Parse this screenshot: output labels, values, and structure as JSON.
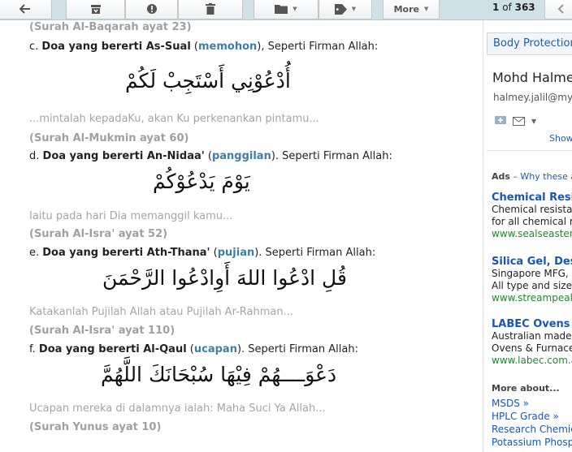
{
  "toolbar": {
    "more_label": "More",
    "pager": {
      "current": "1",
      "of_label": "of",
      "total": "363"
    }
  },
  "message": {
    "ref_baqarah": "(Surah Al-Baqarah ayat 23)",
    "c": {
      "prefix": "c. ",
      "title": "Doa yang bererti As-Sual",
      "open": " (",
      "keyword": "memohon",
      "close": "), Seperti Firman Allah:"
    },
    "c_arabic": "أُدْعُوْنِي أَسْتَجِبْ لَكُمْ",
    "c_trans": "...mintalah kepadaKu, akan Ku perkenankan pintamu...",
    "ref_mukmin": "(Surah Al-Mukmin ayat 60)",
    "d": {
      "prefix": "d. ",
      "title": "Doa yang bererti An-Nidaa'",
      "open": " (",
      "keyword": "panggilan",
      "close": "). Seperti Firman Allah:"
    },
    "d_arabic": "يَوْمَ يَدْعُوْكُمْ",
    "d_trans": "Iaitu pada hari Dia memanggil kamu...",
    "ref_isra52": "(Surah Al-Isra' ayat 52)",
    "e": {
      "prefix": "e. ",
      "title": "Doa yang bererti Ath-Thana'",
      "open": " (",
      "keyword": "pujian",
      "close": "). Seperti Firman Allah:"
    },
    "e_arabic": "قُلِ ادْعُوا اللهَ أَوِادْعُوا الرَّحْمَنَ",
    "e_trans": "Katakanlah Pujilah Allah atau Pujilah Ar-Rahman...",
    "ref_isra110": "(Surah Al-Isra' ayat 110)",
    "f": {
      "prefix": "f. ",
      "title": "Doa yang bererti Al-Qaul",
      "open": " (",
      "keyword": "ucapan",
      "close": "). Seperti Firman Allah:"
    },
    "f_arabic": "دَعْوَــــهُمْ فِيْهَا سُبْحَانَكَ اللَّهُمَّ",
    "f_trans": "Ucapan mereka di dalamnya ialah: Maha Suci Ya Allah...",
    "ref_yunus": "(Surah Yunus ayat 10)"
  },
  "sidebar": {
    "label_chip": "Body Protection",
    "contact_name": "Mohd Halmey",
    "contact_email": "halmey.jalil@my.",
    "show_link": "Show",
    "ads_label": "Ads",
    "ads_note": " – Why these ac",
    "ads": [
      {
        "title": "Chemical Resi",
        "desc1": "Chemical resistar",
        "desc2": "for all chemical re",
        "url": "www.sealseaster"
      },
      {
        "title": "Silica Gel, Des",
        "desc1": "Singapore MFG,",
        "desc2": "All type and sizes",
        "url": "www.streampeak"
      },
      {
        "title": "LABEC Ovens",
        "desc1": "Australian made",
        "desc2": "Ovens & Furnace",
        "url": "www.labec.com.a"
      }
    ],
    "more_about": "More about...",
    "related": [
      "MSDS »",
      "HPLC Grade »",
      "Research Chemic",
      "Potassium Phosp"
    ]
  },
  "colors": {
    "toolbar_bg": "#cfe0e6",
    "keyword": "#3f7fa6",
    "reference": "#a0a0a0",
    "link": "#1a55b5",
    "ad_url": "#1f8a2a"
  }
}
